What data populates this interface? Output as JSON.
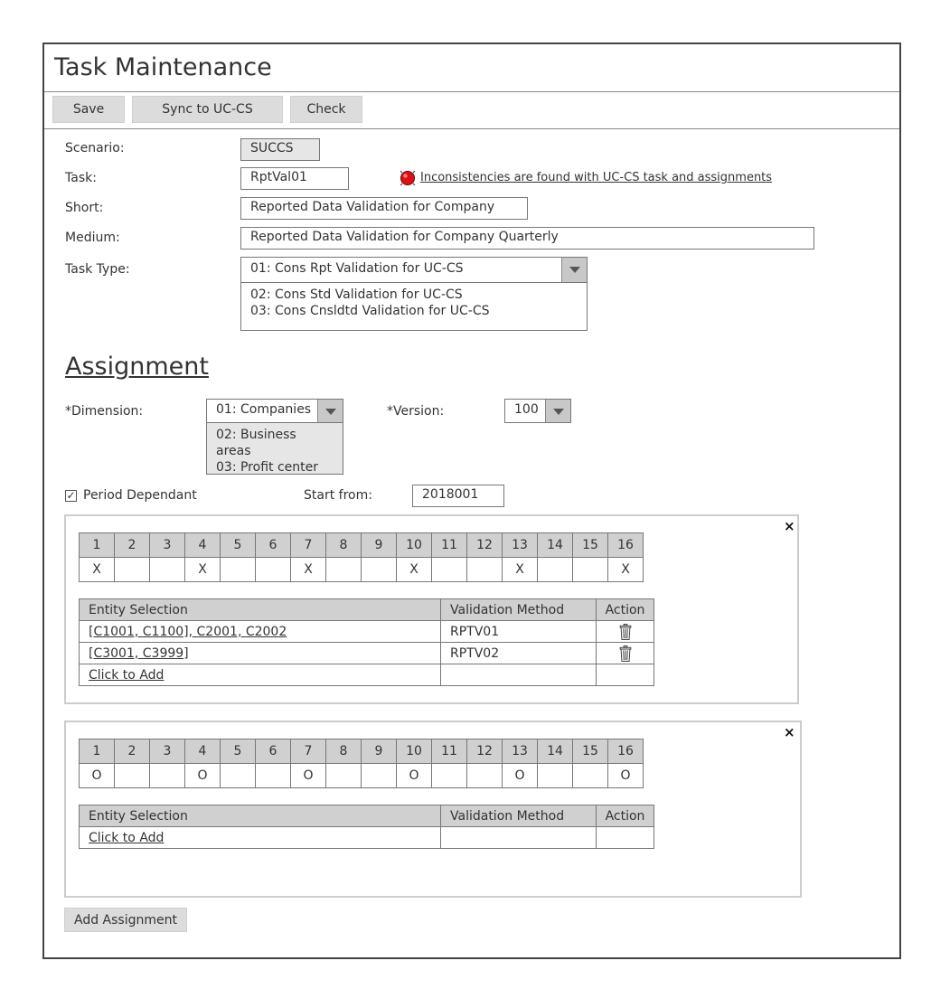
{
  "header": {
    "title": "Task Maintenance"
  },
  "toolbar": {
    "save": "Save",
    "sync": "Sync to UC-CS",
    "check": "Check"
  },
  "form": {
    "scenario_label": "Scenario:",
    "scenario_value": "SUCCS",
    "task_label": "Task:",
    "task_value": "RptVal01",
    "warning_text": "Inconsistencies are found with UC-CS task and assignments",
    "short_label": "Short:",
    "short_value": "Reported Data Validation for Company",
    "medium_label": "Medium:",
    "medium_value": "Reported Data Validation for Company Quarterly",
    "task_type_label": "Task Type:",
    "task_type_value": "01: Cons Rpt Validation for UC-CS",
    "task_type_options": [
      "02: Cons Std Validation for UC-CS",
      "03: Cons Cnsldtd Validation for UC-CS"
    ]
  },
  "assignment": {
    "heading": "Assignment",
    "dimension_label": "*Dimension:",
    "dimension_value": "01: Companies",
    "dimension_options": [
      "02: Business areas",
      "03: Profit center"
    ],
    "version_label": "*Version:",
    "version_value": "100",
    "period_label": "Period Dependant",
    "period_checked": "✓",
    "start_label": "Start from:",
    "start_value": "2018001",
    "add_button": "Add Assignment"
  },
  "periods": [
    "1",
    "2",
    "3",
    "4",
    "5",
    "6",
    "7",
    "8",
    "9",
    "10",
    "11",
    "12",
    "13",
    "14",
    "15",
    "16"
  ],
  "panels": [
    {
      "marks": [
        "X",
        "",
        "",
        "X",
        "",
        "",
        "X",
        "",
        "",
        "X",
        "",
        "",
        "X",
        "",
        "",
        "X"
      ],
      "headers": {
        "entity": "Entity Selection",
        "method": "Validation Method",
        "action": "Action"
      },
      "rows": [
        {
          "entity": "[C1001, C1100], C2001, C2002",
          "method": "RPTV01"
        },
        {
          "entity": "[C3001, C3999]",
          "method": "RPTV02"
        }
      ],
      "add_text": "Click to Add"
    },
    {
      "marks": [
        "O",
        "",
        "",
        "O",
        "",
        "",
        "O",
        "",
        "",
        "O",
        "",
        "",
        "O",
        "",
        "",
        "O"
      ],
      "headers": {
        "entity": "Entity Selection",
        "method": "Validation Method",
        "action": "Action"
      },
      "rows": [],
      "add_text": "Click to Add"
    }
  ],
  "close_glyph": "×",
  "colors": {
    "warning": "#e01010",
    "button": "#dcdcdc",
    "header_cell": "#d0d0d0"
  }
}
